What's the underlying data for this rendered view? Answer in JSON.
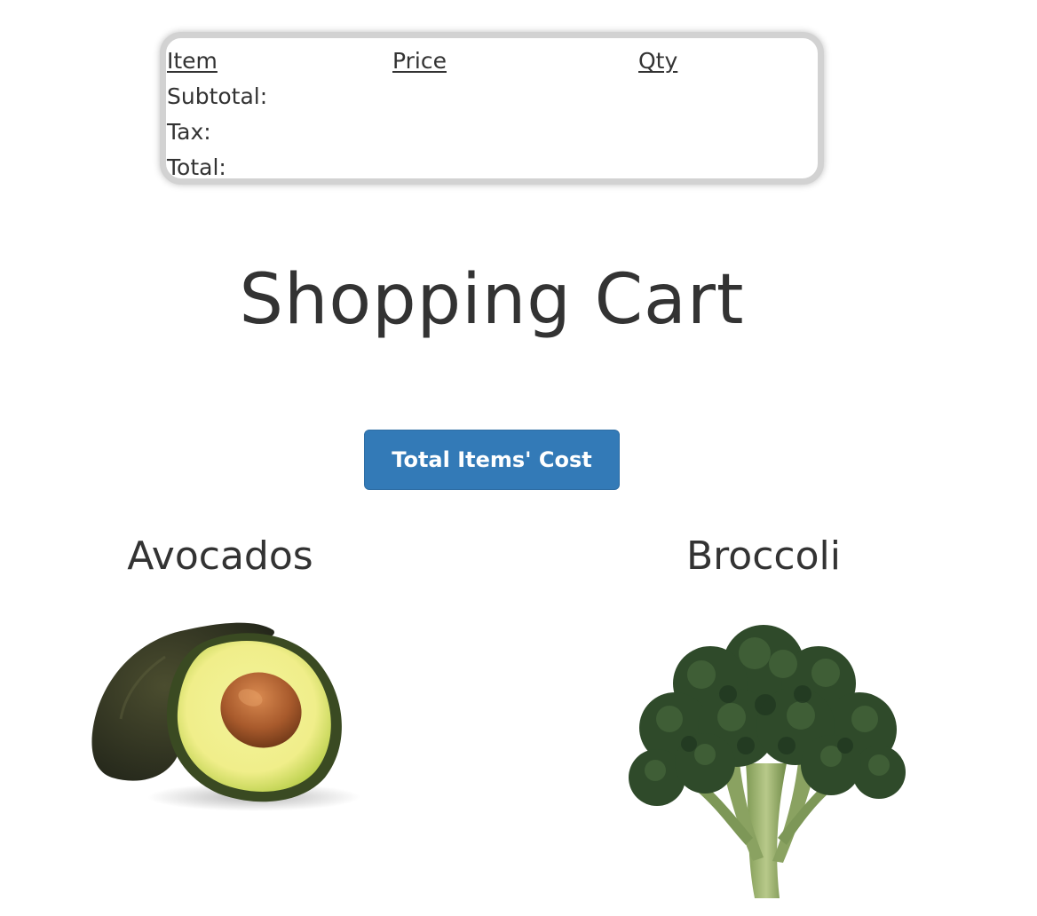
{
  "summary": {
    "headers": {
      "item": "Item",
      "price": "Price",
      "qty": "Qty"
    },
    "rows": {
      "subtotal": "Subtotal:",
      "tax": "Tax:",
      "total": "Total:"
    }
  },
  "page": {
    "title": "Shopping Cart"
  },
  "actions": {
    "total_button_label": "Total Items' Cost"
  },
  "products": [
    {
      "name": "Avocados",
      "image": "avocado-image"
    },
    {
      "name": "Broccoli",
      "image": "broccoli-image"
    }
  ],
  "colors": {
    "button_bg": "#337ab7",
    "button_text": "#ffffff",
    "text": "#333333",
    "card_border": "#d2d2d2"
  }
}
